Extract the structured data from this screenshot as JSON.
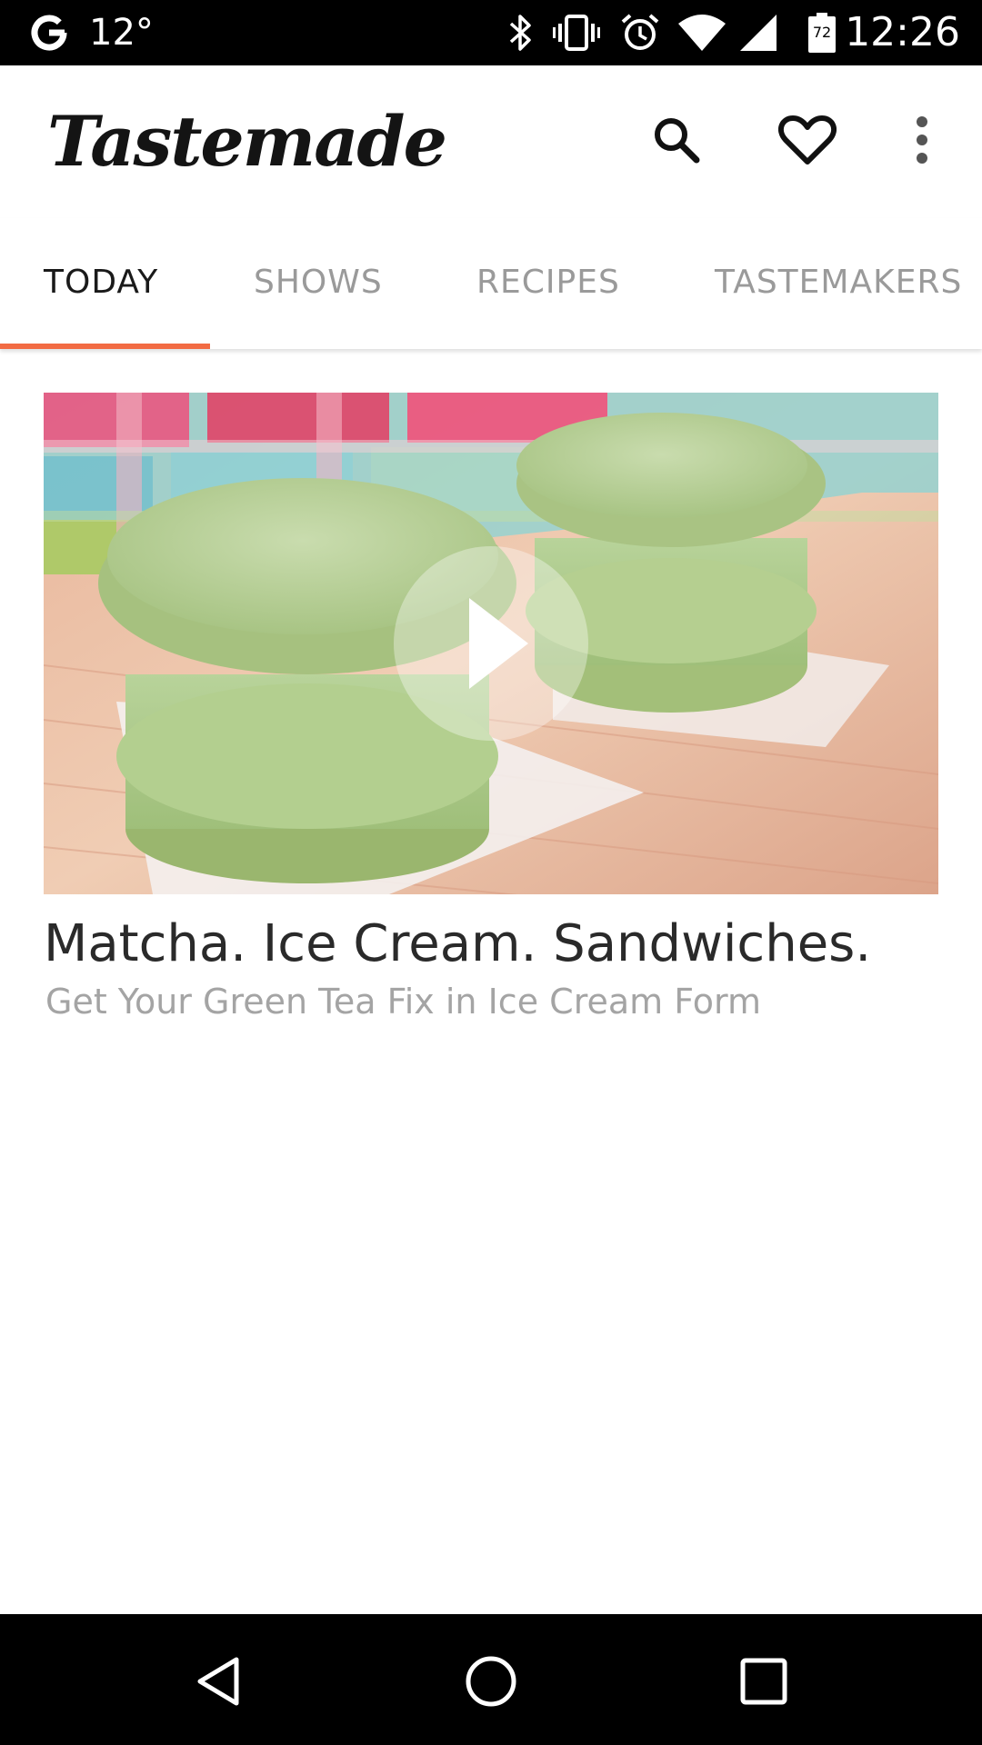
{
  "status_bar": {
    "temperature": "12°",
    "battery_level": "72",
    "time": "12:26",
    "icons": [
      "google-g-icon",
      "bluetooth-icon",
      "vibrate-icon",
      "alarm-icon",
      "wifi-icon",
      "cell-signal-icon",
      "battery-icon"
    ]
  },
  "app_bar": {
    "logo_text": "Tastemade",
    "actions": [
      "search-icon",
      "heart-icon",
      "more-vert-icon"
    ]
  },
  "tabs": [
    {
      "label": "TODAY",
      "active": true
    },
    {
      "label": "SHOWS",
      "active": false
    },
    {
      "label": "RECIPES",
      "active": false
    },
    {
      "label": "TASTEMAKERS",
      "active": false
    }
  ],
  "card": {
    "title": "Matcha. Ice Cream. Sandwiches.",
    "subtitle": "Get Your Green Tea Fix in Ice Cream Form",
    "play_icon": "play-icon"
  },
  "nav_bar": {
    "buttons": [
      "back-icon",
      "home-icon",
      "recents-icon"
    ]
  },
  "colors": {
    "accent": "#f26b43",
    "active_tab_text": "#1a1a1a",
    "inactive_tab_text": "#9a9a9a",
    "title_text": "#2a2a2a",
    "subtitle_text": "#a4a4a4"
  }
}
